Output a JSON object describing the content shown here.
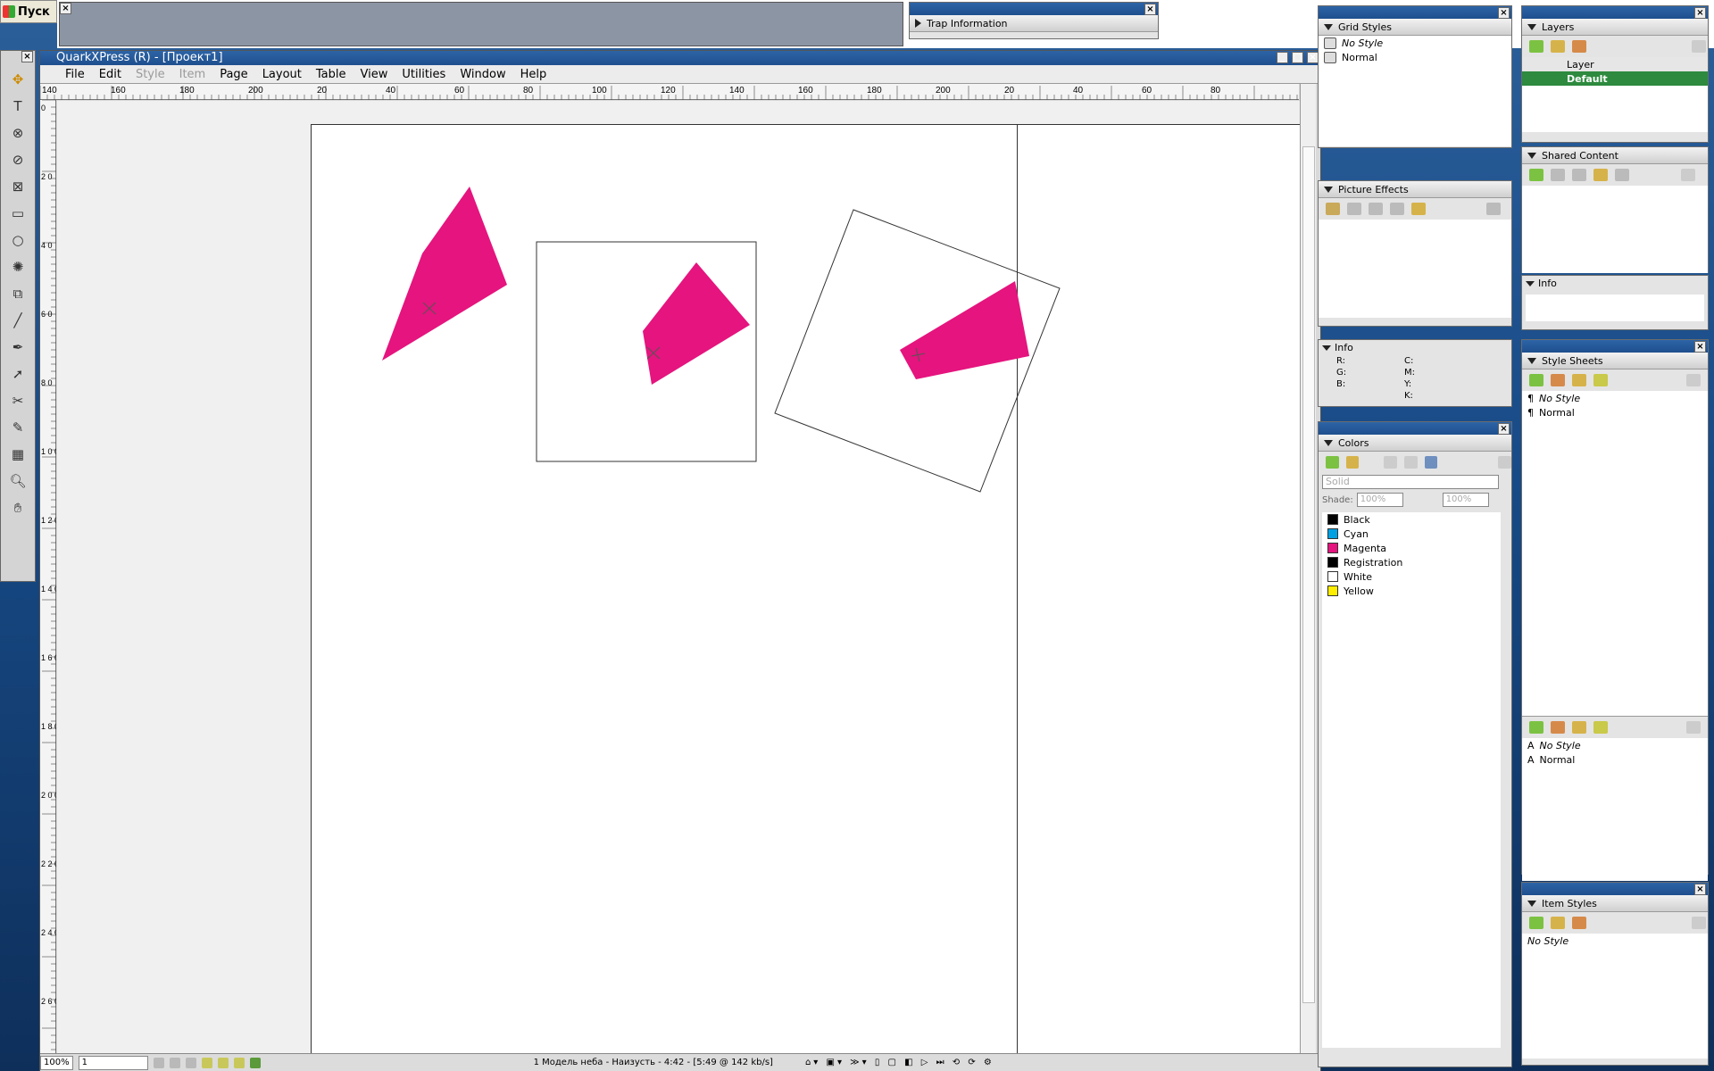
{
  "taskbar": {
    "start_label": "Пуск"
  },
  "trap_palette": {
    "title": "Trap Information"
  },
  "quark": {
    "title": "QuarkXPress (R) - [Проект1]",
    "menu": [
      "File",
      "Edit",
      "Style",
      "Item",
      "Page",
      "Layout",
      "Table",
      "View",
      "Utilities",
      "Window",
      "Help"
    ],
    "menu_disabled": [
      "Style",
      "Item"
    ],
    "ruler_h": [
      "140",
      "160",
      "180",
      "200",
      "20",
      "40",
      "60",
      "80",
      "100",
      "120",
      "140",
      "160",
      "180",
      "200",
      "20",
      "40",
      "60",
      "80"
    ],
    "ruler_v": [
      "0",
      "2 0",
      "4 0",
      "6 0",
      "8 0",
      "1 0 0",
      "1 2 0",
      "1 4 0",
      "1 6 0",
      "1 8 0",
      "2 0 0",
      "2 2 0",
      "2 4 0",
      "2 6 0"
    ],
    "status": {
      "zoom": "100%",
      "page": "1",
      "media_text": "1 Модель неба - Наизусть - 4:42 - [5:49 @ 142 kb/s]"
    }
  },
  "grid_styles": {
    "title": "Grid Styles",
    "items": [
      "No Style",
      "Normal"
    ]
  },
  "picture_effects": {
    "title": "Picture Effects"
  },
  "info_small": {
    "title": "Info",
    "rows": [
      [
        "R:",
        "C:"
      ],
      [
        "G:",
        "M:"
      ],
      [
        "B:",
        "Y:"
      ],
      [
        "",
        "K:"
      ]
    ]
  },
  "colors": {
    "title": "Colors",
    "mode": "Solid",
    "shade_label": "Shade:",
    "shade_value": "100%",
    "opacity_value": "100%",
    "items": [
      {
        "name": "Black",
        "hex": "#000000"
      },
      {
        "name": "Cyan",
        "hex": "#00a0e3"
      },
      {
        "name": "Magenta",
        "hex": "#e5147e"
      },
      {
        "name": "Registration",
        "hex": "#000000"
      },
      {
        "name": "White",
        "hex": "#ffffff"
      },
      {
        "name": "Yellow",
        "hex": "#ffed00"
      }
    ]
  },
  "layers": {
    "title": "Layers",
    "header": "Layer",
    "selected": "Default"
  },
  "shared_content": {
    "title": "Shared Content"
  },
  "info_large": {
    "title": "Info"
  },
  "style_sheets": {
    "title": "Style Sheets",
    "para": [
      "No Style",
      "Normal"
    ],
    "char": [
      "No Style",
      "Normal"
    ]
  },
  "item_styles": {
    "title": "Item Styles",
    "items": [
      "No Style"
    ]
  },
  "colors_theme": {
    "accent": "#e5147e",
    "layer_sel": "#2d8a3e",
    "titlebar": "#2d64a6"
  }
}
